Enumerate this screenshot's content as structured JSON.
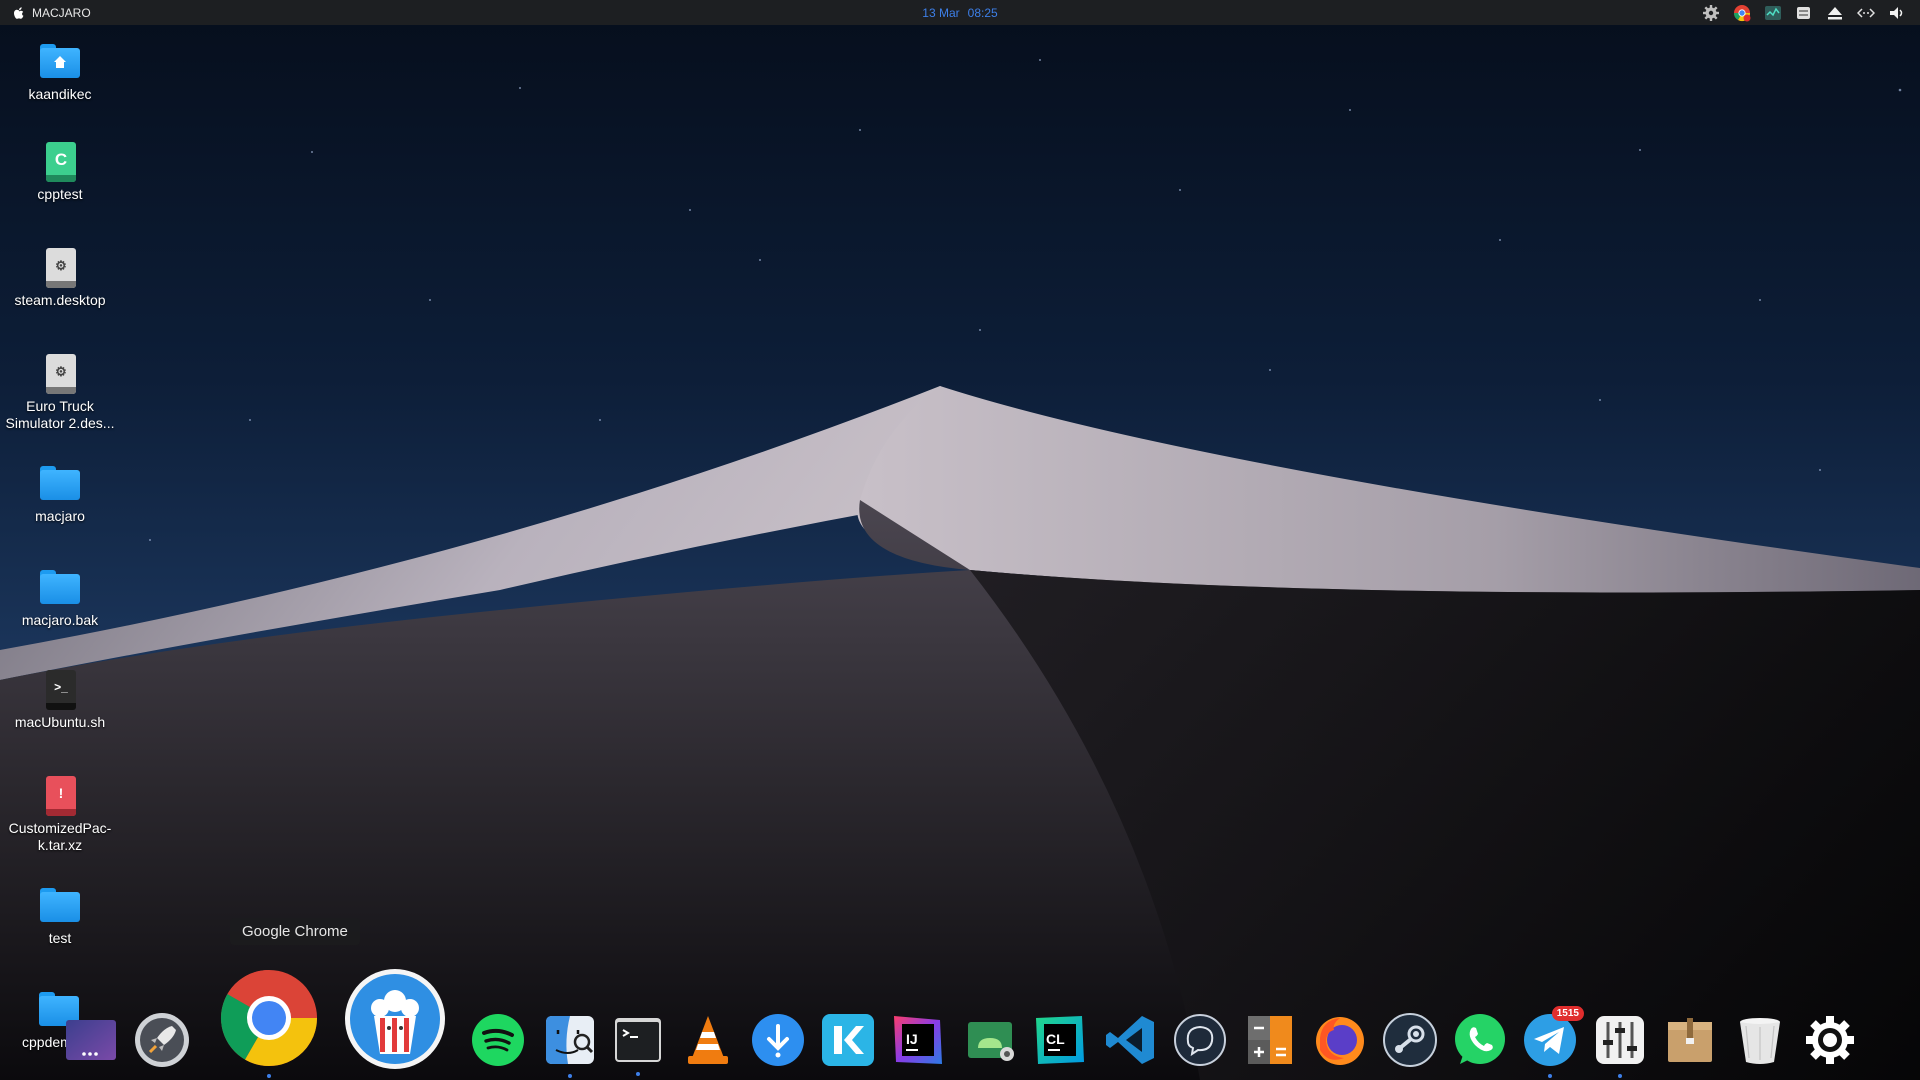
{
  "menubar": {
    "app_name": "MACJARO",
    "date": "13 Mar",
    "time": "08:25",
    "tray_icons": [
      "gear-icon",
      "chrome-tray-icon",
      "activity-monitor-icon",
      "keyboard-icon",
      "eject-icon",
      "network-icon",
      "volume-icon"
    ]
  },
  "desktop": {
    "items": [
      {
        "label": "kaandikec",
        "kind": "home-folder"
      },
      {
        "label": "cpptest",
        "kind": "c-file",
        "badge": "C"
      },
      {
        "label": "steam.desktop",
        "kind": "desktop-file"
      },
      {
        "label": "Euro Truck Simulator 2.des...",
        "kind": "desktop-file"
      },
      {
        "label": "macjaro",
        "kind": "folder"
      },
      {
        "label": "macjaro.bak",
        "kind": "folder"
      },
      {
        "label": "macUbuntu.sh",
        "kind": "script-file",
        "badge": ">_"
      },
      {
        "label": "CustomizedPac-k.tar.xz",
        "kind": "archive-file",
        "badge": "!"
      },
      {
        "label": "test",
        "kind": "folder"
      },
      {
        "label": "cppdem",
        "kind": "folder"
      }
    ]
  },
  "tooltip": {
    "text": "Google Chrome"
  },
  "dock": {
    "apps": [
      {
        "name": "Workspaces",
        "icon": "workspaces-icon"
      },
      {
        "name": "Launchpad",
        "icon": "rocket-icon"
      },
      {
        "name": "Google Chrome",
        "icon": "chrome-icon",
        "running": true
      },
      {
        "name": "Popcorn Time",
        "icon": "popcorn-icon"
      },
      {
        "name": "Spotify",
        "icon": "spotify-icon"
      },
      {
        "name": "Finder",
        "icon": "finder-icon",
        "running": true
      },
      {
        "name": "Terminal",
        "icon": "terminal-icon",
        "running": true
      },
      {
        "name": "VLC",
        "icon": "vlc-cone-icon"
      },
      {
        "name": "Downloader",
        "icon": "download-icon"
      },
      {
        "name": "Kodi",
        "icon": "kodi-icon"
      },
      {
        "name": "IntelliJ IDEA",
        "icon": "intellij-icon"
      },
      {
        "name": "Android Studio",
        "icon": "android-studio-icon"
      },
      {
        "name": "CLion",
        "icon": "clion-icon"
      },
      {
        "name": "Visual Studio Code",
        "icon": "vscode-icon"
      },
      {
        "name": "Messenger",
        "icon": "messenger-icon"
      },
      {
        "name": "Calculator",
        "icon": "calculator-icon"
      },
      {
        "name": "Firefox",
        "icon": "firefox-icon"
      },
      {
        "name": "Steam",
        "icon": "steam-icon"
      },
      {
        "name": "WhatsApp",
        "icon": "whatsapp-icon"
      },
      {
        "name": "Telegram",
        "icon": "telegram-icon",
        "badge": "1515",
        "running": true
      },
      {
        "name": "Mixer",
        "icon": "mixer-icon",
        "running": true
      },
      {
        "name": "Archive Manager",
        "icon": "archive-box-icon"
      },
      {
        "name": "Trash",
        "icon": "trash-icon"
      },
      {
        "name": "Settings",
        "icon": "settings-gear-icon"
      }
    ]
  },
  "colors": {
    "menubar_bg": "#1d1f22",
    "clock": "#3d7fe8",
    "folder": "#2ba6ff",
    "sky_top": "#07101f",
    "sky_bottom": "#12284a"
  }
}
